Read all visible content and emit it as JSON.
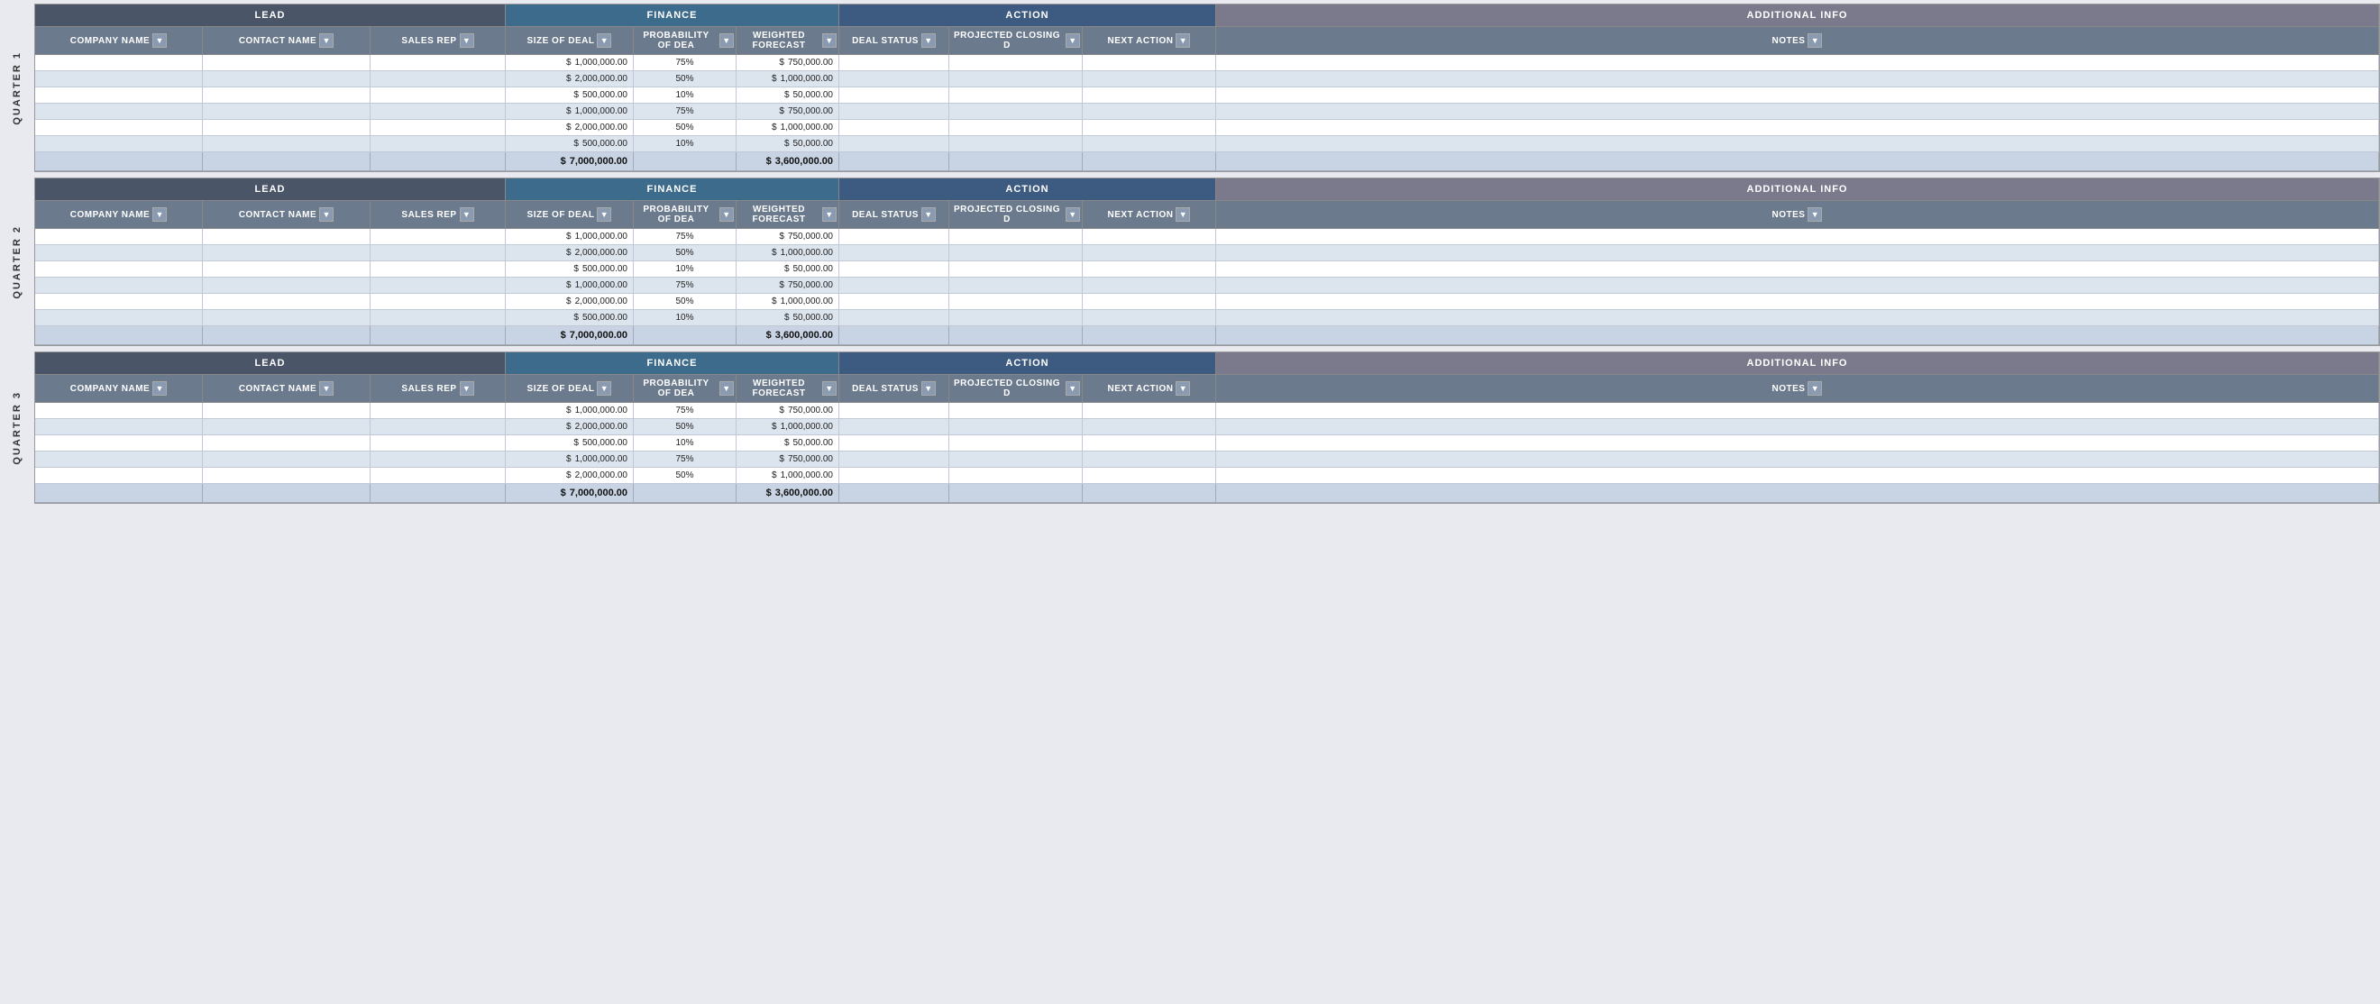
{
  "quarters": [
    {
      "id": "q1",
      "label": "QUARTER 1",
      "groups": {
        "lead": "LEAD",
        "finance": "FINANCE",
        "action": "ACTION",
        "additional": "ADDITIONAL INFO"
      },
      "columns": {
        "company": "COMPANY NAME",
        "contact": "CONTACT NAME",
        "salesrep": "SALES REP",
        "sizedeal": "SIZE OF DEAL",
        "probability": "PROBABILITY OF DEA",
        "weighted": "WEIGHTED FORECAST",
        "dealstatus": "DEAL STATUS",
        "projclosing": "PROJECTED CLOSING D",
        "nextaction": "NEXT ACTION",
        "notes": "NOTES"
      },
      "rows": [
        {
          "company": "",
          "contact": "",
          "salesrep": "",
          "dollar1": "$",
          "sizedeal": "1,000,000.00",
          "probability": "75%",
          "dollar2": "$",
          "weighted": "750,000.00",
          "dealstatus": "",
          "projclosing": "",
          "nextaction": "",
          "notes": ""
        },
        {
          "company": "",
          "contact": "",
          "salesrep": "",
          "dollar1": "$",
          "sizedeal": "2,000,000.00",
          "probability": "50%",
          "dollar2": "$",
          "weighted": "1,000,000.00",
          "dealstatus": "",
          "projclosing": "",
          "nextaction": "",
          "notes": ""
        },
        {
          "company": "",
          "contact": "",
          "salesrep": "",
          "dollar1": "$",
          "sizedeal": "500,000.00",
          "probability": "10%",
          "dollar2": "$",
          "weighted": "50,000.00",
          "dealstatus": "",
          "projclosing": "",
          "nextaction": "",
          "notes": ""
        },
        {
          "company": "",
          "contact": "",
          "salesrep": "",
          "dollar1": "$",
          "sizedeal": "1,000,000.00",
          "probability": "75%",
          "dollar2": "$",
          "weighted": "750,000.00",
          "dealstatus": "",
          "projclosing": "",
          "nextaction": "",
          "notes": ""
        },
        {
          "company": "",
          "contact": "",
          "salesrep": "",
          "dollar1": "$",
          "sizedeal": "2,000,000.00",
          "probability": "50%",
          "dollar2": "$",
          "weighted": "1,000,000.00",
          "dealstatus": "",
          "projclosing": "",
          "nextaction": "",
          "notes": ""
        },
        {
          "company": "",
          "contact": "",
          "salesrep": "",
          "dollar1": "$",
          "sizedeal": "500,000.00",
          "probability": "10%",
          "dollar2": "$",
          "weighted": "50,000.00",
          "dealstatus": "",
          "projclosing": "",
          "nextaction": "",
          "notes": ""
        }
      ],
      "total": {
        "dollar1": "$",
        "sizedeal": "7,000,000.00",
        "dollar2": "$",
        "weighted": "3,600,000.00"
      }
    },
    {
      "id": "q2",
      "label": "QUARTER 2",
      "groups": {
        "lead": "LEAD",
        "finance": "FINANCE",
        "action": "ACTION",
        "additional": "ADDITIONAL INFO"
      },
      "columns": {
        "company": "COMPANY NAME",
        "contact": "CONTACT NAME",
        "salesrep": "SALES REP",
        "sizedeal": "SIZE OF DEAL",
        "probability": "PROBABILITY OF DEA",
        "weighted": "WEIGHTED FORECAST",
        "dealstatus": "DEAL STATUS",
        "projclosing": "PROJECTED CLOSING D",
        "nextaction": "NEXT ACTION",
        "notes": "NOTES"
      },
      "rows": [
        {
          "company": "",
          "contact": "",
          "salesrep": "",
          "dollar1": "$",
          "sizedeal": "1,000,000.00",
          "probability": "75%",
          "dollar2": "$",
          "weighted": "750,000.00",
          "dealstatus": "",
          "projclosing": "",
          "nextaction": "",
          "notes": ""
        },
        {
          "company": "",
          "contact": "",
          "salesrep": "",
          "dollar1": "$",
          "sizedeal": "2,000,000.00",
          "probability": "50%",
          "dollar2": "$",
          "weighted": "1,000,000.00",
          "dealstatus": "",
          "projclosing": "",
          "nextaction": "",
          "notes": ""
        },
        {
          "company": "",
          "contact": "",
          "salesrep": "",
          "dollar1": "$",
          "sizedeal": "500,000.00",
          "probability": "10%",
          "dollar2": "$",
          "weighted": "50,000.00",
          "dealstatus": "",
          "projclosing": "",
          "nextaction": "",
          "notes": ""
        },
        {
          "company": "",
          "contact": "",
          "salesrep": "",
          "dollar1": "$",
          "sizedeal": "1,000,000.00",
          "probability": "75%",
          "dollar2": "$",
          "weighted": "750,000.00",
          "dealstatus": "",
          "projclosing": "",
          "nextaction": "",
          "notes": ""
        },
        {
          "company": "",
          "contact": "",
          "salesrep": "",
          "dollar1": "$",
          "sizedeal": "2,000,000.00",
          "probability": "50%",
          "dollar2": "$",
          "weighted": "1,000,000.00",
          "dealstatus": "",
          "projclosing": "",
          "nextaction": "",
          "notes": ""
        },
        {
          "company": "",
          "contact": "",
          "salesrep": "",
          "dollar1": "$",
          "sizedeal": "500,000.00",
          "probability": "10%",
          "dollar2": "$",
          "weighted": "50,000.00",
          "dealstatus": "",
          "projclosing": "",
          "nextaction": "",
          "notes": ""
        }
      ],
      "total": {
        "dollar1": "$",
        "sizedeal": "7,000,000.00",
        "dollar2": "$",
        "weighted": "3,600,000.00"
      }
    },
    {
      "id": "q3",
      "label": "QUARTER 3",
      "groups": {
        "lead": "LEAD",
        "finance": "FINANCE",
        "action": "ACTION",
        "additional": "ADDITIONAL INFO"
      },
      "columns": {
        "company": "COMPANY NAME",
        "contact": "CONTACT NAME",
        "salesrep": "SALES REP",
        "sizedeal": "SIZE OF DEAL",
        "probability": "PROBABILITY OF DEA",
        "weighted": "WEIGHTED FORECAST",
        "dealstatus": "DEAL STATUS",
        "projclosing": "PROJECTED CLOSING D",
        "nextaction": "NEXT ACTION",
        "notes": "NOTES"
      },
      "rows": [
        {
          "company": "",
          "contact": "",
          "salesrep": "",
          "dollar1": "$",
          "sizedeal": "1,000,000.00",
          "probability": "75%",
          "dollar2": "$",
          "weighted": "750,000.00",
          "dealstatus": "",
          "projclosing": "",
          "nextaction": "",
          "notes": ""
        },
        {
          "company": "",
          "contact": "",
          "salesrep": "",
          "dollar1": "$",
          "sizedeal": "2,000,000.00",
          "probability": "50%",
          "dollar2": "$",
          "weighted": "1,000,000.00",
          "dealstatus": "",
          "projclosing": "",
          "nextaction": "",
          "notes": ""
        },
        {
          "company": "",
          "contact": "",
          "salesrep": "",
          "dollar1": "$",
          "sizedeal": "500,000.00",
          "probability": "10%",
          "dollar2": "$",
          "weighted": "50,000.00",
          "dealstatus": "",
          "projclosing": "",
          "nextaction": "",
          "notes": ""
        },
        {
          "company": "",
          "contact": "",
          "salesrep": "",
          "dollar1": "$",
          "sizedeal": "1,000,000.00",
          "probability": "75%",
          "dollar2": "$",
          "weighted": "750,000.00",
          "dealstatus": "",
          "projclosing": "",
          "nextaction": "",
          "notes": ""
        },
        {
          "company": "",
          "contact": "",
          "salesrep": "",
          "dollar1": "$",
          "sizedeal": "2,000,000.00",
          "probability": "50%",
          "dollar2": "$",
          "weighted": "1,000,000.00",
          "dealstatus": "",
          "projclosing": "",
          "nextaction": "",
          "notes": ""
        }
      ],
      "total": {
        "dollar1": "$",
        "sizedeal": "7,000,000.00",
        "dollar2": "$",
        "weighted": "3,600,000.00"
      }
    }
  ],
  "icons": {
    "dropdown": "▼"
  }
}
